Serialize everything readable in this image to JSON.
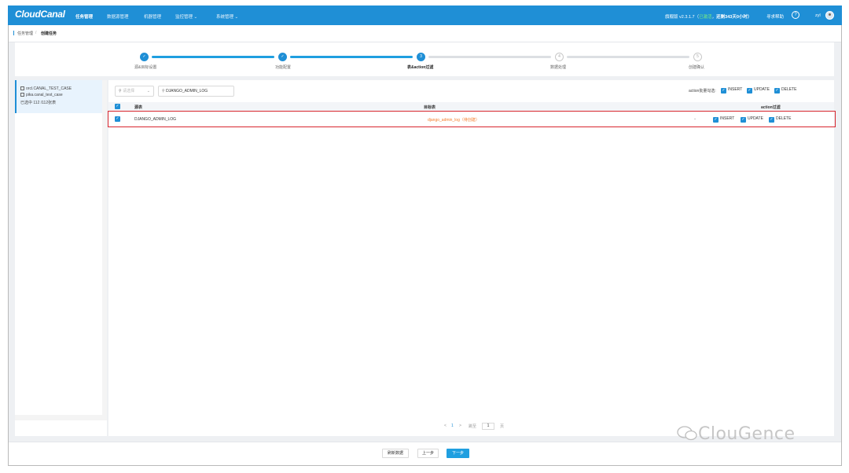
{
  "nav": {
    "logo": "CloudCanal",
    "items": [
      "任务管理",
      "数据源管理",
      "机器管理",
      "监控管理 ⌄",
      "系统管理 ⌄"
    ],
    "edition": "旗舰版 v2.3.1.7",
    "paren_open": "（",
    "status": "已激活",
    "paren_close": "，",
    "license": "还剩343天0小时）",
    "help": "寻求帮助",
    "user": "zyl"
  },
  "breadcrumb": {
    "parent": "任务管理",
    "separator": "/",
    "current": "创建任务"
  },
  "steps": [
    {
      "label": "源&目标设置",
      "state": "done"
    },
    {
      "label": "功能配置",
      "state": "done"
    },
    {
      "label": "表&action过滤",
      "state": "current",
      "number": "3"
    },
    {
      "label": "数据处理",
      "state": "todo",
      "number": "4"
    },
    {
      "label": "创建确认",
      "state": "todo",
      "number": "5"
    }
  ],
  "left": {
    "db1": "orcl.CANAL_TEST_CASE",
    "db2": "pika.canal_test_case",
    "selected": "已选中 112 /112张表"
  },
  "filters": {
    "select_placeholder": "请选择",
    "search_value": "DJANGO_ADMIN_LOG",
    "batch_label": "action批量勾选:",
    "insert": "INSERT",
    "update": "UPDATE",
    "delete": "DELETE"
  },
  "table": {
    "headers": {
      "source": "源表",
      "target": "目标表",
      "action": "action过滤"
    },
    "rows": [
      {
        "source": "DJANGO_ADMIN_LOG",
        "target": "django_admin_log（待创建）",
        "insert": "INSERT",
        "update": "UPDATE",
        "delete": "DELETE"
      }
    ]
  },
  "pagination": {
    "prev": "<",
    "page": "1",
    "next": ">",
    "goto": "跳至",
    "goto_value": "1",
    "page_unit": "页"
  },
  "watermark": "ClouGence",
  "footer": {
    "refresh": "刷新数据",
    "prev": "上一步",
    "next": "下一步"
  },
  "colors": {
    "primary": "#1f8fd6",
    "target_pending": "#f57c2a",
    "highlight_border": "#d8262e"
  }
}
